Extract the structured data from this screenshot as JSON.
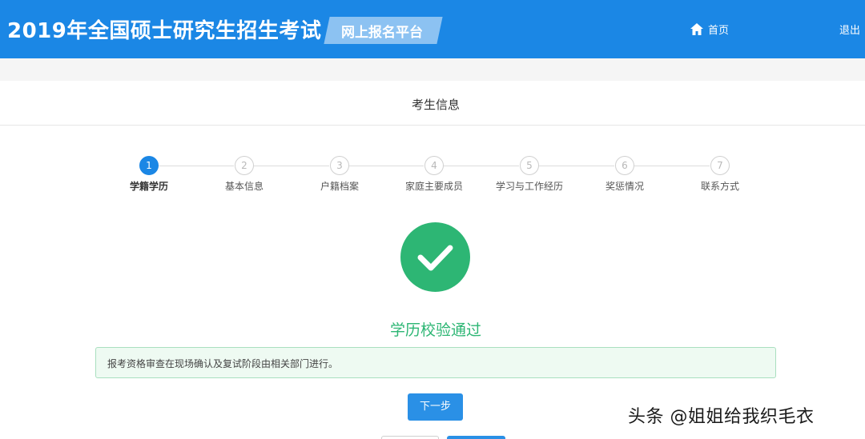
{
  "header": {
    "site_title": "2019年全国硕士研究生招生考试",
    "platform_label": "网上报名平台",
    "home_label": "首页",
    "logout_label": "退出",
    "bg_color": "#1b87e5"
  },
  "section": {
    "title": "考生信息"
  },
  "steps": [
    {
      "number": "1",
      "label": "学籍学历",
      "active": true
    },
    {
      "number": "2",
      "label": "基本信息",
      "active": false
    },
    {
      "number": "3",
      "label": "户籍档案",
      "active": false
    },
    {
      "number": "4",
      "label": "家庭主要成员",
      "active": false
    },
    {
      "number": "5",
      "label": "学习与工作经历",
      "active": false
    },
    {
      "number": "6",
      "label": "奖惩情况",
      "active": false
    },
    {
      "number": "7",
      "label": "联系方式",
      "active": false
    }
  ],
  "result": {
    "icon": "check-circle-icon",
    "message": "学历校验通过",
    "color": "#2db674",
    "notice": "报考资格审查在现场确认及复试阶段由相关部门进行。"
  },
  "actions": {
    "next_label": "下一步"
  },
  "watermark": {
    "text": "头条 @姐姐给我织毛衣"
  }
}
